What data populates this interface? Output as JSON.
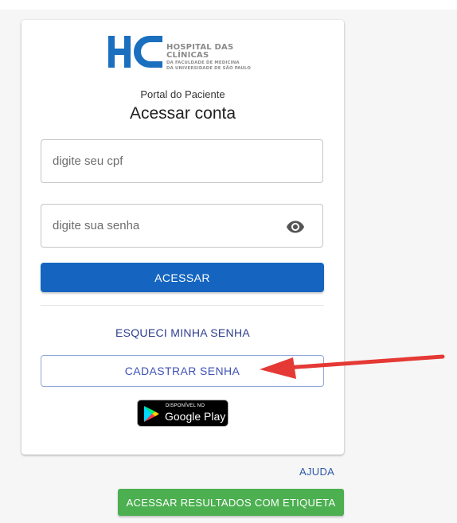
{
  "logo": {
    "letters": "HC",
    "line1": "HOSPITAL DAS CLÍNICAS",
    "line2": "DA FACULDADE DE MEDICINA",
    "line3": "DA UNIVERSIDADE DE SÃO PAULO",
    "color": "#1a6fbf"
  },
  "header": {
    "subtitle": "Portal do Paciente",
    "title": "Acessar conta"
  },
  "form": {
    "cpf_placeholder": "digite seu cpf",
    "password_placeholder": "digite sua senha",
    "password_toggle_icon": "eye-icon",
    "submit_label": "ACESSAR",
    "forgot_label": "ESQUECI MINHA SENHA",
    "register_label": "CADASTRAR SENHA"
  },
  "google_play": {
    "small_text": "DISPONÍVEL NO",
    "big_text": "Google Play"
  },
  "footer": {
    "help_label": "AJUDA",
    "results_label": "ACESSAR RESULTADOS COM ETIQUETA"
  },
  "colors": {
    "primary": "#1565c0",
    "success": "#4caf50",
    "annotation_arrow": "#e53935"
  }
}
